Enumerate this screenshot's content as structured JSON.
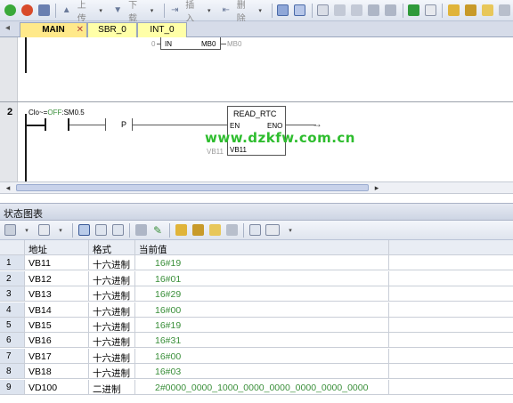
{
  "toolbar": {
    "upload_label": "上传",
    "download_label": "下载",
    "insert_label": "插入",
    "delete_label": "删除"
  },
  "tabs": [
    {
      "label": "MAIN",
      "active": true
    },
    {
      "label": "SBR_0",
      "active": false
    },
    {
      "label": "INT_0",
      "active": false
    }
  ],
  "ladder": {
    "top_network": {
      "in_label": "IN",
      "out_label": "MB0",
      "ghost_right": "MB0",
      "ghost_left": "0"
    },
    "network_2": {
      "number": "2",
      "contact_prefix": "Clo~=",
      "contact_state": "OFF",
      "contact_addr": ":SM0.5",
      "edge_label": "P",
      "block_name": "READ_RTC",
      "en_label": "EN",
      "eno_label": "ENO",
      "t_label": "VB11",
      "t_ghost": "VB11"
    }
  },
  "watermark": "www.dzkfw.com.cn",
  "panel": {
    "title": "状态图表"
  },
  "status_chart": {
    "headers": {
      "address": "地址",
      "format": "格式",
      "current_value": "当前值"
    },
    "rows": [
      {
        "num": "1",
        "address": "VB11",
        "format": "十六进制",
        "value": "16#19"
      },
      {
        "num": "2",
        "address": "VB12",
        "format": "十六进制",
        "value": "16#01"
      },
      {
        "num": "3",
        "address": "VB13",
        "format": "十六进制",
        "value": "16#29"
      },
      {
        "num": "4",
        "address": "VB14",
        "format": "十六进制",
        "value": "16#00"
      },
      {
        "num": "5",
        "address": "VB15",
        "format": "十六进制",
        "value": "16#19"
      },
      {
        "num": "6",
        "address": "VB16",
        "format": "十六进制",
        "value": "16#31"
      },
      {
        "num": "7",
        "address": "VB17",
        "format": "十六进制",
        "value": "16#00"
      },
      {
        "num": "8",
        "address": "VB18",
        "format": "十六进制",
        "value": "16#03"
      },
      {
        "num": "9",
        "address": "VD100",
        "format": "二进制",
        "value": "2#0000_0000_1000_0000_0000_0000_0000_0000"
      }
    ]
  },
  "colors": {
    "tab_active": "#ffe98a",
    "tab_inactive": "#ffffa8",
    "value_green": "#3a8f3a",
    "watermark_green": "#2ebd2e"
  }
}
